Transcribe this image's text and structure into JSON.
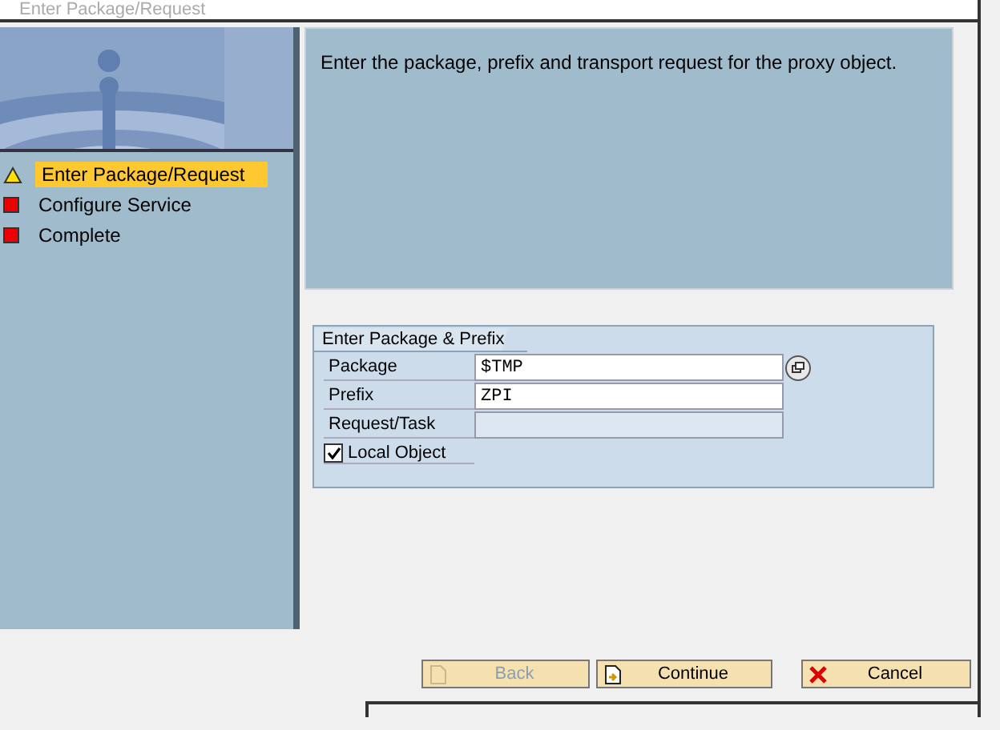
{
  "window": {
    "title": "Enter Package/Request"
  },
  "steps": [
    {
      "label": "Enter Package/Request",
      "kind": "warning",
      "selected": true
    },
    {
      "label": "Configure Service",
      "kind": "error",
      "selected": false
    },
    {
      "label": "Complete",
      "kind": "error",
      "selected": false
    }
  ],
  "info": {
    "text": "Enter the package, prefix and transport request for the proxy object."
  },
  "group": {
    "title": "Enter Package & Prefix",
    "fields": [
      {
        "label": "Package",
        "value": "$TMP",
        "disabled": false,
        "help": true
      },
      {
        "label": "Prefix",
        "value": "ZPI",
        "disabled": false,
        "help": false
      },
      {
        "label": "Request/Task",
        "disabled": true,
        "help": false
      }
    ],
    "checkbox": {
      "label": "Local Object",
      "checked": true
    }
  },
  "buttons": [
    {
      "label": "Back",
      "kind": "back",
      "disabled": true
    },
    {
      "label": "Continue",
      "kind": "continue",
      "disabled": false
    },
    {
      "label": "Cancel",
      "kind": "cancel",
      "disabled": false
    }
  ]
}
